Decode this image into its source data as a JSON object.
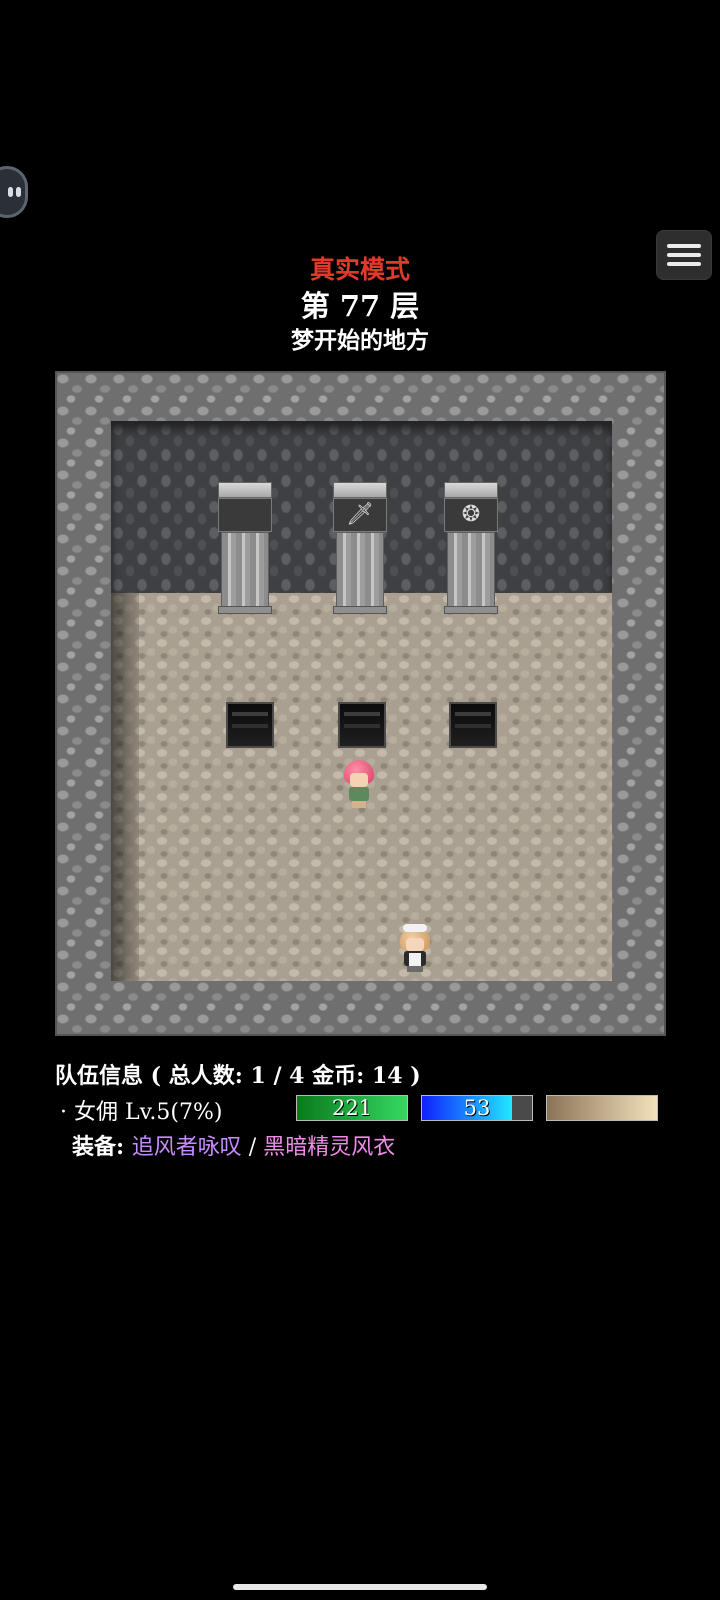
{
  "header": {
    "mode": "真实模式",
    "floor": "第 77 层",
    "map_name": "梦开始的地方"
  },
  "colors": {
    "mode_red": "#e23a2a",
    "weapon_purple": "#c78dff",
    "armor_pink": "#f08ce8",
    "hp_green": "#35d861",
    "mp_blue": "#1021ff"
  },
  "icons": {
    "menu": "hamburger-menu-icon",
    "assist": "assistive-bubble-icon",
    "pillar_1": "blank-tablet",
    "pillar_2": "sword",
    "pillar_3": "rune-circle"
  },
  "map": {
    "pillar_symbols": [
      "",
      "🗡",
      "❂"
    ]
  },
  "party": {
    "title": "队伍信息 ( 总人数: 1 / 4 金币: 14 )",
    "members": [
      {
        "name_line": "· 女佣 Lv.5(7%)",
        "hp": "221",
        "hp_ratio": 1.0,
        "mp": "53",
        "mp_ratio": 0.82,
        "xp_ratio": 1.0,
        "equip_label": "装备: ",
        "weapon": "追风者咏叹",
        "separator": " / ",
        "armor": "黑暗精灵风衣"
      }
    ]
  }
}
